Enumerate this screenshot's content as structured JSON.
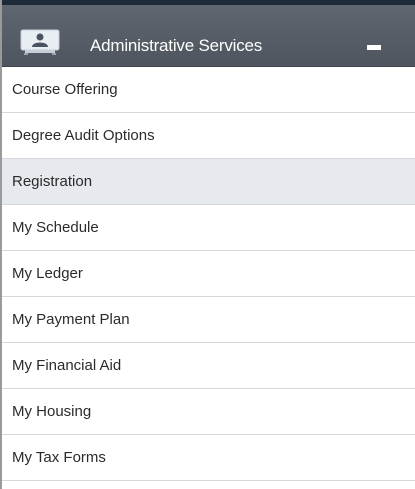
{
  "header": {
    "title": "Administrative Services",
    "icon": "user-card-icon",
    "collapse_icon": "minus-icon"
  },
  "menu": {
    "items": [
      {
        "label": "Course Offering",
        "active": false
      },
      {
        "label": "Degree Audit Options",
        "active": false
      },
      {
        "label": "Registration",
        "active": true
      },
      {
        "label": "My Schedule",
        "active": false
      },
      {
        "label": "My Ledger",
        "active": false
      },
      {
        "label": "My Payment Plan",
        "active": false
      },
      {
        "label": "My Financial Aid",
        "active": false
      },
      {
        "label": "My Housing",
        "active": false
      },
      {
        "label": "My Tax Forms",
        "active": false
      }
    ]
  },
  "colors": {
    "header_background": "#555c65",
    "top_strip": "#1c2a3a",
    "active_item_background": "#e6e9ed",
    "divider": "#d5d8dc"
  }
}
